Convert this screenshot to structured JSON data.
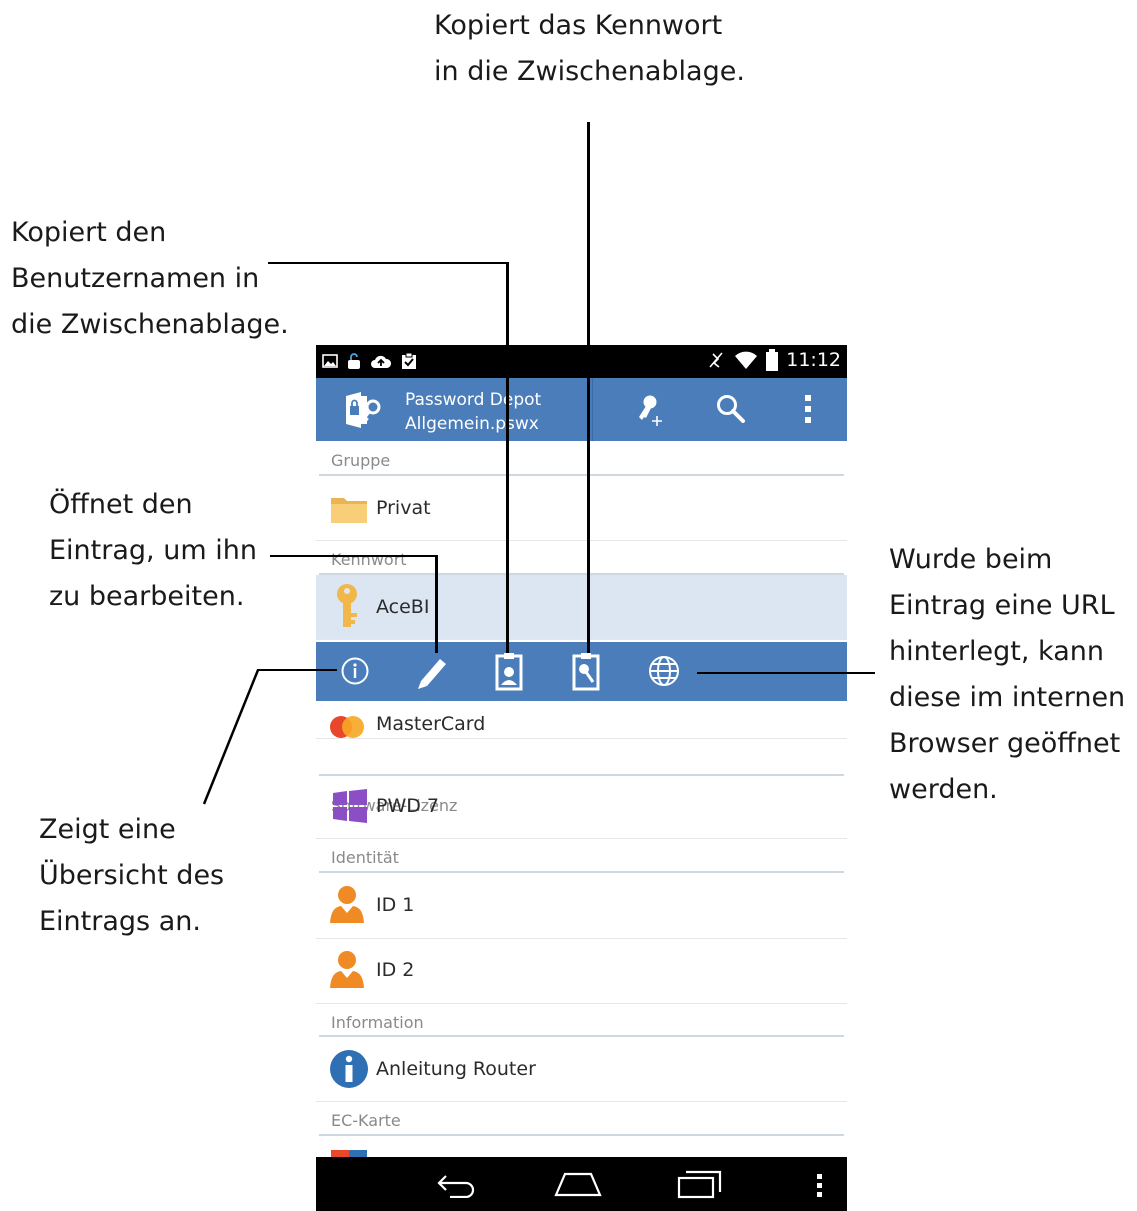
{
  "callouts": {
    "password": [
      "Kopiert das Kennwort",
      "in die Zwischenablage."
    ],
    "username": [
      "Kopiert den",
      "Benutzernamen in",
      "die Zwischenablage."
    ],
    "edit": [
      "Öffnet den",
      "Eintrag, um ihn",
      "zu bearbeiten."
    ],
    "url": [
      "Wurde beim",
      "Eintrag eine URL",
      "hinterlegt, kann",
      "diese im internen",
      "Browser geöffnet",
      "werden."
    ],
    "overview": [
      "Zeigt eine",
      "Übersicht des",
      "Eintrags an."
    ]
  },
  "status_bar": {
    "time": "11:12",
    "left_icons": [
      "image-icon",
      "lock-icon",
      "cloud-upload-icon",
      "clipboard-check-icon"
    ],
    "right_icons": [
      "vibrate-off-icon",
      "wifi-icon",
      "battery-icon"
    ]
  },
  "app_bar": {
    "title": "Password Depot",
    "subtitle": "Allgemein.pswx",
    "actions": [
      "add-key-icon",
      "search-icon",
      "overflow-menu-icon"
    ]
  },
  "list": {
    "sections": [
      {
        "header": "Gruppe",
        "items": [
          {
            "label": "Privat",
            "icon": "folder-icon"
          }
        ]
      },
      {
        "header": "Kennwort",
        "items": [
          {
            "label": "AceBI",
            "icon": "key-icon",
            "selected": true
          },
          {
            "label": "MasterCard",
            "icon": "credit-card-icon"
          }
        ]
      },
      {
        "header": "Software-Lizenz",
        "items": [
          {
            "label": "PWD 7",
            "icon": "windows-logo-icon"
          }
        ]
      },
      {
        "header": "Identität",
        "items": [
          {
            "label": "ID 1",
            "icon": "person-icon"
          },
          {
            "label": "ID 2",
            "icon": "person-icon"
          }
        ]
      },
      {
        "header": "Information",
        "items": [
          {
            "label": "Anleitung Router",
            "icon": "info-icon"
          }
        ]
      },
      {
        "header": "EC-Karte",
        "items": []
      }
    ]
  },
  "action_bar": {
    "actions": [
      "info-icon",
      "pencil-icon",
      "copy-username-icon",
      "copy-password-icon",
      "globe-icon"
    ]
  },
  "nav_bar": {
    "buttons": [
      "back-icon",
      "home-icon",
      "recent-apps-icon",
      "menu-icon"
    ]
  },
  "colors": {
    "accent": "#4a7db9",
    "selected_row": "#dbe6f2",
    "person": "#f08a24",
    "windows": "#8b4ec4",
    "folder": "#f5c466"
  }
}
